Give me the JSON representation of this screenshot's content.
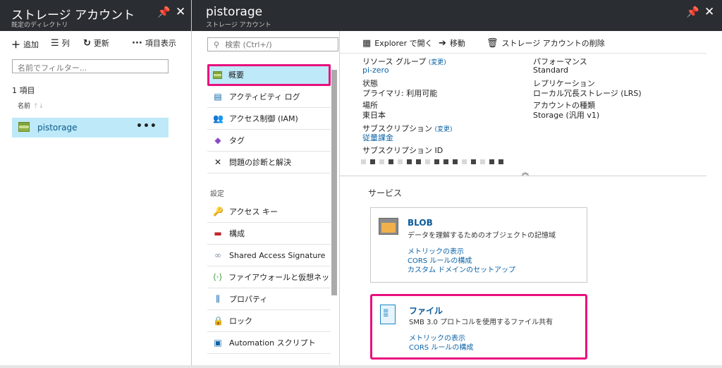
{
  "left_blade": {
    "title": "ストレージ アカウント",
    "subtitle": "既定のディレクトリ",
    "pin_icon": "pin-icon",
    "close_icon": "close-icon",
    "commands": {
      "add": "追加",
      "columns": "列",
      "refresh": "更新",
      "more": "項目表示"
    },
    "filter_placeholder": "名前でフィルター...",
    "count": "1 項目",
    "column_name": "名前",
    "resource": {
      "name": "pistorage",
      "more": "•••"
    }
  },
  "main_blade": {
    "title": "pistorage",
    "subtitle": "ストレージ アカウント",
    "search_placeholder": "検索 (Ctrl+/)",
    "menu": [
      {
        "icon": "overview-icon",
        "label": "概要",
        "selected": true
      },
      {
        "icon": "activity-log-icon",
        "label": "アクティビティ ログ"
      },
      {
        "icon": "access-control-icon",
        "label": "アクセス制御 (IAM)"
      },
      {
        "icon": "tag-icon",
        "label": "タグ"
      },
      {
        "icon": "diagnose-icon",
        "label": "問題の診断と解決"
      }
    ],
    "settings_label": "設定",
    "settings_menu": [
      {
        "icon": "key-icon",
        "label": "アクセス キー"
      },
      {
        "icon": "config-icon",
        "label": "構成"
      },
      {
        "icon": "link-icon",
        "label": "Shared Access Signature"
      },
      {
        "icon": "firewall-icon",
        "label": "ファイアウォールと仮想ネットワーク (..."
      },
      {
        "icon": "properties-icon",
        "label": "プロパティ"
      },
      {
        "icon": "lock-icon",
        "label": "ロック"
      },
      {
        "icon": "automation-icon",
        "label": "Automation スクリプト"
      }
    ],
    "toolbar": {
      "explorer": "Explorer で開く",
      "move": "移動",
      "delete": "ストレージ アカウントの削除"
    },
    "essentials": {
      "resource_group_label": "リソース グループ",
      "change": "(変更)",
      "resource_group": "pi-zero",
      "status_label": "状態",
      "status": "プライマリ: 利用可能",
      "location_label": "場所",
      "location": "東日本",
      "subscription_label": "サブスクリプション",
      "subscription": "従量課金",
      "subscription_id_label": "サブスクリプション ID",
      "performance_label": "パフォーマンス",
      "performance": "Standard",
      "replication_label": "レプリケーション",
      "replication": "ローカル冗長ストレージ (LRS)",
      "account_kind_label": "アカウントの種類",
      "account_kind": "Storage (汎用 v1)"
    },
    "services_label": "サービス",
    "services": [
      {
        "icon": "blob-icon",
        "title": "BLOB",
        "desc": "データを理解するためのオブジェクトの記憶域",
        "links": [
          "メトリックの表示",
          "CORS ルールの構成",
          "カスタム ドメインのセットアップ"
        ]
      },
      {
        "icon": "file-icon",
        "title": "ファイル",
        "desc": "SMB 3.0 プロトコルを使用するファイル共有",
        "links": [
          "メトリックの表示",
          "CORS ルールの構成"
        ]
      }
    ]
  }
}
